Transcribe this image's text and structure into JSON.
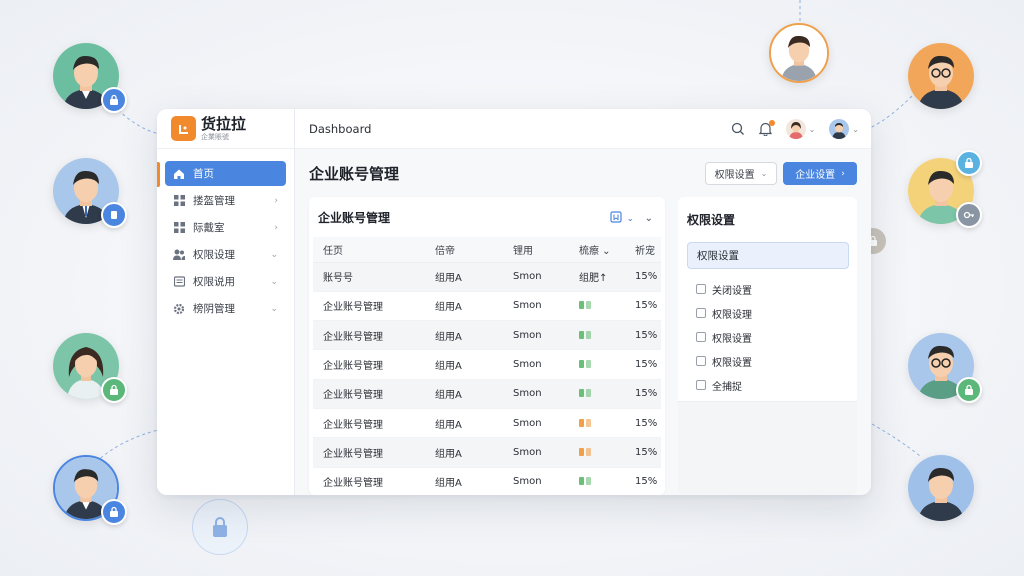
{
  "app": {
    "logo_title": "货拉拉",
    "logo_sub": "企業賬號",
    "topbar_title": "Dashboard"
  },
  "sidebar": {
    "items": [
      {
        "label": "首页",
        "icon": "home-icon",
        "active": true,
        "chevron": ""
      },
      {
        "label": "搂盔管理",
        "icon": "grid-icon",
        "chevron": "›"
      },
      {
        "label": "际戴室",
        "icon": "grid-icon",
        "chevron": "›"
      },
      {
        "label": "权限设理",
        "icon": "users-icon",
        "chevron": "⌄"
      },
      {
        "label": "权限说用",
        "icon": "doc-icon",
        "chevron": "⌄"
      },
      {
        "label": "榜阴管理",
        "icon": "gear-icon",
        "chevron": "⌄"
      }
    ]
  },
  "header": {
    "page_title": "企业账号管理",
    "btn_outline": "权限设置",
    "btn_primary": "企业设置"
  },
  "table_card": {
    "title": "企业账号管理",
    "columns": [
      "任页",
      "倍帝",
      "锂用",
      "梳瘵 ⌄",
      "祈宠"
    ],
    "rows": [
      [
        "账号号",
        "组用A",
        "Smon",
        "组肥↑",
        "15%"
      ],
      [
        "企业账号管理",
        "组用A",
        "Smon",
        "",
        "15%"
      ],
      [
        "企业账号管理",
        "组用A",
        "Smon",
        "",
        "15%"
      ],
      [
        "企业账号管理",
        "组用A",
        "Smon",
        "",
        "15%"
      ],
      [
        "企业账号管理",
        "组用A",
        "Smon",
        "",
        "15%"
      ],
      [
        "企业账号管理",
        "组用A",
        "Smon",
        "",
        "15%"
      ],
      [
        "企业账号管理",
        "组用A",
        "Smon",
        "",
        "15%"
      ],
      [
        "企业账号管理",
        "组用A",
        "Smon",
        "",
        "15%"
      ]
    ],
    "status_colors": [
      "",
      "#6cbf7a",
      "#6cbf7a",
      "#6cbf7a",
      "#6cbf7a",
      "#f0a04b",
      "#f0a04b",
      "#6cbf7a"
    ]
  },
  "permissions_panel": {
    "title": "权限设置",
    "selected": "权限设置",
    "checks": [
      "关闭设置",
      "权限设理",
      "权限设置",
      "权限设置",
      "全捕捉"
    ]
  },
  "colors": {
    "accent": "#4a86e0",
    "brand": "#f08a2c",
    "badge_blue": "#4a86e0",
    "badge_green": "#5cb87a"
  }
}
